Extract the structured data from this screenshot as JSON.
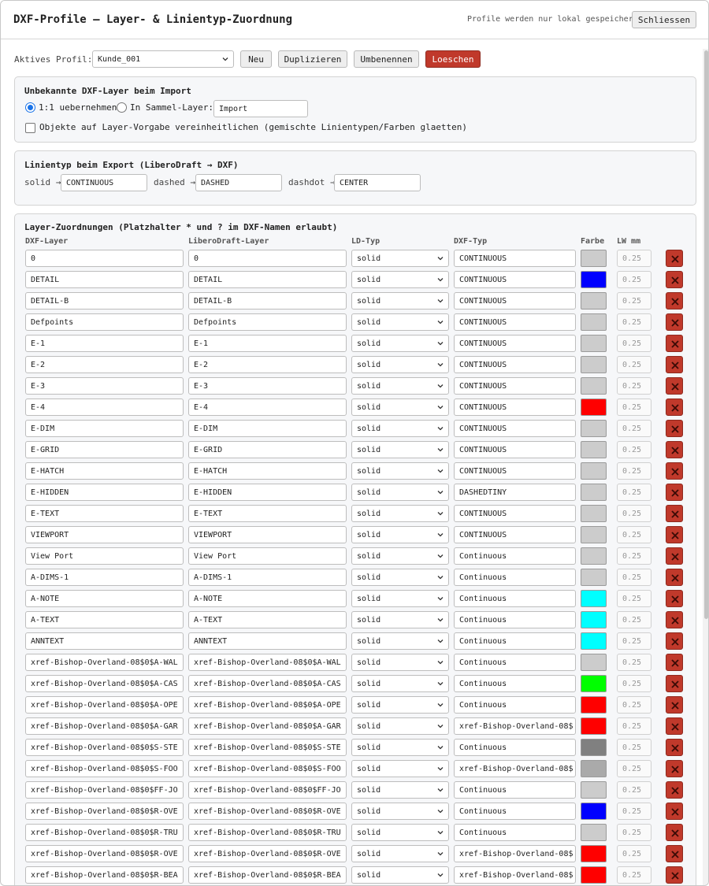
{
  "window": {
    "title": "DXF-Profile — Layer- & Linientyp-Zuordnung",
    "note": "Profile werden nur lokal gespeichert",
    "close_label": "Schliessen"
  },
  "profile": {
    "label": "Aktives Profil:",
    "selected": "Kunde_001",
    "new_label": "Neu",
    "duplicate_label": "Duplizieren",
    "rename_label": "Umbenennen",
    "delete_label": "Loeschen"
  },
  "unknown_layers": {
    "title": "Unbekannte DXF-Layer beim Import",
    "option_keep_label": "1:1 uebernehmen",
    "option_keep_selected": true,
    "option_collect_label": "In Sammel-Layer:",
    "collect_value": "Import",
    "unify_label": "Objekte auf Layer-Vorgabe vereinheitlichen (gemischte Linientypen/Farben glaetten)",
    "unify_checked": false
  },
  "export_linetypes": {
    "title": "Linientyp beim Export (LiberoDraft → DXF)",
    "solid_label": "solid →",
    "solid_value": "CONTINUOUS",
    "dashed_label": "dashed →",
    "dashed_value": "DASHED",
    "dashdot_label": "dashdot →",
    "dashdot_value": "CENTER"
  },
  "mappings": {
    "title": "Layer-Zuordnungen (Platzhalter * und ? im DXF-Namen erlaubt)",
    "headers": {
      "dxf_layer": "DXF-Layer",
      "ld_layer": "LiberoDraft-Layer",
      "ld_type": "LD-Typ",
      "dxf_type": "DXF-Typ",
      "color": "Farbe",
      "lw": "LW mm"
    },
    "rows": [
      {
        "dxf": "0",
        "ld": "0",
        "ld_type": "solid",
        "dxf_type": "CONTINUOUS",
        "color": "#cccccc",
        "lw": "0.25"
      },
      {
        "dxf": "DETAIL",
        "ld": "DETAIL",
        "ld_type": "solid",
        "dxf_type": "CONTINUOUS",
        "color": "#0000ff",
        "lw": "0.25"
      },
      {
        "dxf": "DETAIL-B",
        "ld": "DETAIL-B",
        "ld_type": "solid",
        "dxf_type": "CONTINUOUS",
        "color": "#cccccc",
        "lw": "0.25"
      },
      {
        "dxf": "Defpoints",
        "ld": "Defpoints",
        "ld_type": "solid",
        "dxf_type": "CONTINUOUS",
        "color": "#cccccc",
        "lw": "0.25"
      },
      {
        "dxf": "E-1",
        "ld": "E-1",
        "ld_type": "solid",
        "dxf_type": "CONTINUOUS",
        "color": "#cccccc",
        "lw": "0.25"
      },
      {
        "dxf": "E-2",
        "ld": "E-2",
        "ld_type": "solid",
        "dxf_type": "CONTINUOUS",
        "color": "#cccccc",
        "lw": "0.25"
      },
      {
        "dxf": "E-3",
        "ld": "E-3",
        "ld_type": "solid",
        "dxf_type": "CONTINUOUS",
        "color": "#cccccc",
        "lw": "0.25"
      },
      {
        "dxf": "E-4",
        "ld": "E-4",
        "ld_type": "solid",
        "dxf_type": "CONTINUOUS",
        "color": "#ff0000",
        "lw": "0.25"
      },
      {
        "dxf": "E-DIM",
        "ld": "E-DIM",
        "ld_type": "solid",
        "dxf_type": "CONTINUOUS",
        "color": "#cccccc",
        "lw": "0.25"
      },
      {
        "dxf": "E-GRID",
        "ld": "E-GRID",
        "ld_type": "solid",
        "dxf_type": "CONTINUOUS",
        "color": "#cccccc",
        "lw": "0.25"
      },
      {
        "dxf": "E-HATCH",
        "ld": "E-HATCH",
        "ld_type": "solid",
        "dxf_type": "CONTINUOUS",
        "color": "#cccccc",
        "lw": "0.25"
      },
      {
        "dxf": "E-HIDDEN",
        "ld": "E-HIDDEN",
        "ld_type": "solid",
        "dxf_type": "DASHEDTINY",
        "color": "#cccccc",
        "lw": "0.25"
      },
      {
        "dxf": "E-TEXT",
        "ld": "E-TEXT",
        "ld_type": "solid",
        "dxf_type": "CONTINUOUS",
        "color": "#cccccc",
        "lw": "0.25"
      },
      {
        "dxf": "VIEWPORT",
        "ld": "VIEWPORT",
        "ld_type": "solid",
        "dxf_type": "CONTINUOUS",
        "color": "#cccccc",
        "lw": "0.25"
      },
      {
        "dxf": "View Port",
        "ld": "View Port",
        "ld_type": "solid",
        "dxf_type": "Continuous",
        "color": "#cccccc",
        "lw": "0.25"
      },
      {
        "dxf": "A-DIMS-1",
        "ld": "A-DIMS-1",
        "ld_type": "solid",
        "dxf_type": "Continuous",
        "color": "#cccccc",
        "lw": "0.25"
      },
      {
        "dxf": "A-NOTE",
        "ld": "A-NOTE",
        "ld_type": "solid",
        "dxf_type": "Continuous",
        "color": "#00ffff",
        "lw": "0.25"
      },
      {
        "dxf": "A-TEXT",
        "ld": "A-TEXT",
        "ld_type": "solid",
        "dxf_type": "Continuous",
        "color": "#00ffff",
        "lw": "0.25"
      },
      {
        "dxf": "ANNTEXT",
        "ld": "ANNTEXT",
        "ld_type": "solid",
        "dxf_type": "Continuous",
        "color": "#00ffff",
        "lw": "0.25"
      },
      {
        "dxf": "xref-Bishop-Overland-08$0$A-WAL",
        "ld": "xref-Bishop-Overland-08$0$A-WAL",
        "ld_type": "solid",
        "dxf_type": "Continuous",
        "color": "#cccccc",
        "lw": "0.25"
      },
      {
        "dxf": "xref-Bishop-Overland-08$0$A-CAS",
        "ld": "xref-Bishop-Overland-08$0$A-CAS",
        "ld_type": "solid",
        "dxf_type": "Continuous",
        "color": "#00ff00",
        "lw": "0.25"
      },
      {
        "dxf": "xref-Bishop-Overland-08$0$A-OPE",
        "ld": "xref-Bishop-Overland-08$0$A-OPE",
        "ld_type": "solid",
        "dxf_type": "Continuous",
        "color": "#ff0000",
        "lw": "0.25"
      },
      {
        "dxf": "xref-Bishop-Overland-08$0$A-GAR",
        "ld": "xref-Bishop-Overland-08$0$A-GAR",
        "ld_type": "solid",
        "dxf_type": "xref-Bishop-Overland-08$",
        "color": "#ff0000",
        "lw": "0.25"
      },
      {
        "dxf": "xref-Bishop-Overland-08$0$S-STE",
        "ld": "xref-Bishop-Overland-08$0$S-STE",
        "ld_type": "solid",
        "dxf_type": "Continuous",
        "color": "#808080",
        "lw": "0.25"
      },
      {
        "dxf": "xref-Bishop-Overland-08$0$S-FOO",
        "ld": "xref-Bishop-Overland-08$0$S-FOO",
        "ld_type": "solid",
        "dxf_type": "xref-Bishop-Overland-08$",
        "color": "#aaaaaa",
        "lw": "0.25"
      },
      {
        "dxf": "xref-Bishop-Overland-08$0$FF-JO",
        "ld": "xref-Bishop-Overland-08$0$FF-JO",
        "ld_type": "solid",
        "dxf_type": "Continuous",
        "color": "#cccccc",
        "lw": "0.25"
      },
      {
        "dxf": "xref-Bishop-Overland-08$0$R-OVE",
        "ld": "xref-Bishop-Overland-08$0$R-OVE",
        "ld_type": "solid",
        "dxf_type": "Continuous",
        "color": "#0000ff",
        "lw": "0.25"
      },
      {
        "dxf": "xref-Bishop-Overland-08$0$R-TRU",
        "ld": "xref-Bishop-Overland-08$0$R-TRU",
        "ld_type": "solid",
        "dxf_type": "Continuous",
        "color": "#cccccc",
        "lw": "0.25"
      },
      {
        "dxf": "xref-Bishop-Overland-08$0$R-OVE",
        "ld": "xref-Bishop-Overland-08$0$R-OVE",
        "ld_type": "solid",
        "dxf_type": "xref-Bishop-Overland-08$",
        "color": "#ff0000",
        "lw": "0.25"
      },
      {
        "dxf": "xref-Bishop-Overland-08$0$R-BEA",
        "ld": "xref-Bishop-Overland-08$0$R-BEA",
        "ld_type": "solid",
        "dxf_type": "xref-Bishop-Overland-08$",
        "color": "#ff0000",
        "lw": "0.25"
      }
    ]
  }
}
